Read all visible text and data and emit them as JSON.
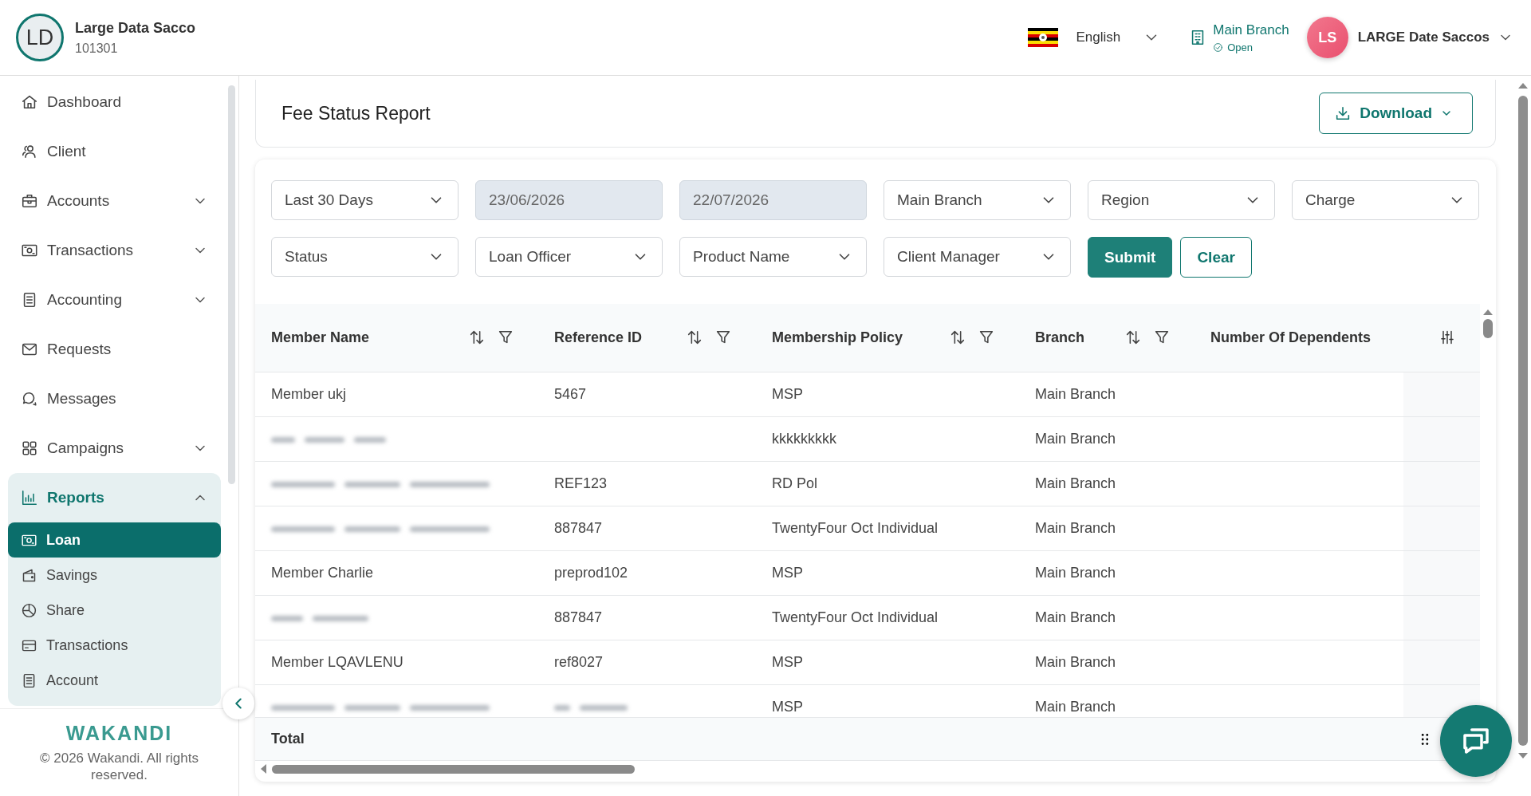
{
  "header": {
    "org_initials": "LD",
    "org_name": "Large Data Sacco",
    "org_code": "101301",
    "language": "English",
    "branch": "Main Branch",
    "branch_status": "Open",
    "user_initials": "LS",
    "user_name": "LARGE Date Saccos"
  },
  "sidebar": {
    "items": [
      {
        "label": "Dashboard",
        "selected": false,
        "expandable": false,
        "expanded": false
      },
      {
        "label": "Client",
        "selected": false,
        "expandable": false,
        "expanded": false
      },
      {
        "label": "Accounts",
        "selected": false,
        "expandable": true,
        "expanded": false
      },
      {
        "label": "Transactions",
        "selected": false,
        "expandable": true,
        "expanded": false
      },
      {
        "label": "Accounting",
        "selected": false,
        "expandable": true,
        "expanded": false
      },
      {
        "label": "Requests",
        "selected": false,
        "expandable": false,
        "expanded": false
      },
      {
        "label": "Messages",
        "selected": false,
        "expandable": false,
        "expanded": false
      },
      {
        "label": "Campaigns",
        "selected": false,
        "expandable": true,
        "expanded": false
      },
      {
        "label": "Reports",
        "selected": true,
        "expandable": true,
        "expanded": true,
        "children": [
          {
            "label": "Loan",
            "selected": true
          },
          {
            "label": "Savings",
            "selected": false
          },
          {
            "label": "Share",
            "selected": false
          },
          {
            "label": "Transactions",
            "selected": false
          },
          {
            "label": "Account",
            "selected": false
          }
        ]
      }
    ],
    "brand": "WAKANDI",
    "copyright": "© 2026 Wakandi. All rights reserved."
  },
  "report": {
    "title": "Fee Status Report",
    "download": "Download",
    "filters": [
      {
        "kind": "select",
        "label": "Last 30 Days",
        "disabled": false
      },
      {
        "kind": "date",
        "label": "23/06/2026",
        "disabled": true
      },
      {
        "kind": "date",
        "label": "22/07/2026",
        "disabled": true
      },
      {
        "kind": "select",
        "label": "Main Branch",
        "disabled": false
      },
      {
        "kind": "select",
        "label": "Region",
        "disabled": false
      },
      {
        "kind": "select",
        "label": "Charge",
        "disabled": false
      },
      {
        "kind": "select",
        "label": "Status",
        "disabled": false
      },
      {
        "kind": "select",
        "label": "Loan Officer",
        "disabled": false
      },
      {
        "kind": "select",
        "label": "Product Name",
        "disabled": false
      },
      {
        "kind": "select",
        "label": "Client Manager",
        "disabled": false
      }
    ],
    "buttons": [
      {
        "kind": "primary",
        "label": "Submit"
      },
      {
        "kind": "outline",
        "label": "Clear"
      }
    ],
    "table": {
      "columns": [
        {
          "label": "Member Name",
          "sortable": true,
          "filterable": true
        },
        {
          "label": "Reference ID",
          "sortable": true,
          "filterable": true
        },
        {
          "label": "Membership Policy",
          "sortable": true,
          "filterable": true
        },
        {
          "label": "Branch",
          "sortable": true,
          "filterable": true
        },
        {
          "label": "Number Of Dependents",
          "sortable": false,
          "filterable": false
        }
      ],
      "rows": [
        {
          "cells": [
            {
              "kind": "text",
              "text": "Member ukj"
            },
            {
              "kind": "text",
              "text": "5467"
            },
            {
              "kind": "text",
              "text": "MSP"
            },
            {
              "kind": "text",
              "text": "Main Branch"
            }
          ]
        },
        {
          "cells": [
            {
              "kind": "blurred"
            },
            {
              "kind": "empty"
            },
            {
              "kind": "text",
              "text": "kkkkkkkkk"
            },
            {
              "kind": "text",
              "text": "Main Branch"
            }
          ]
        },
        {
          "cells": [
            {
              "kind": "blurred"
            },
            {
              "kind": "text",
              "text": "REF123"
            },
            {
              "kind": "text",
              "text": "RD Pol"
            },
            {
              "kind": "text",
              "text": "Main Branch"
            }
          ]
        },
        {
          "cells": [
            {
              "kind": "blurred"
            },
            {
              "kind": "text",
              "text": "887847"
            },
            {
              "kind": "text",
              "text": "TwentyFour Oct Individual"
            },
            {
              "kind": "text",
              "text": "Main Branch"
            }
          ]
        },
        {
          "cells": [
            {
              "kind": "text",
              "text": "Member Charlie"
            },
            {
              "kind": "text",
              "text": "preprod102"
            },
            {
              "kind": "text",
              "text": "MSP"
            },
            {
              "kind": "text",
              "text": "Main Branch"
            }
          ]
        },
        {
          "cells": [
            {
              "kind": "blurred"
            },
            {
              "kind": "text",
              "text": "887847"
            },
            {
              "kind": "text",
              "text": "TwentyFour Oct Individual"
            },
            {
              "kind": "text",
              "text": "Main Branch"
            }
          ]
        },
        {
          "cells": [
            {
              "kind": "text",
              "text": "Member LQAVLENU"
            },
            {
              "kind": "text",
              "text": "ref8027"
            },
            {
              "kind": "text",
              "text": "MSP"
            },
            {
              "kind": "text",
              "text": "Main Branch"
            }
          ]
        },
        {
          "cells": [
            {
              "kind": "blurred"
            },
            {
              "kind": "blurred"
            },
            {
              "kind": "text",
              "text": "MSP"
            },
            {
              "kind": "text",
              "text": "Main Branch"
            }
          ]
        }
      ],
      "total_label": "Total"
    }
  }
}
